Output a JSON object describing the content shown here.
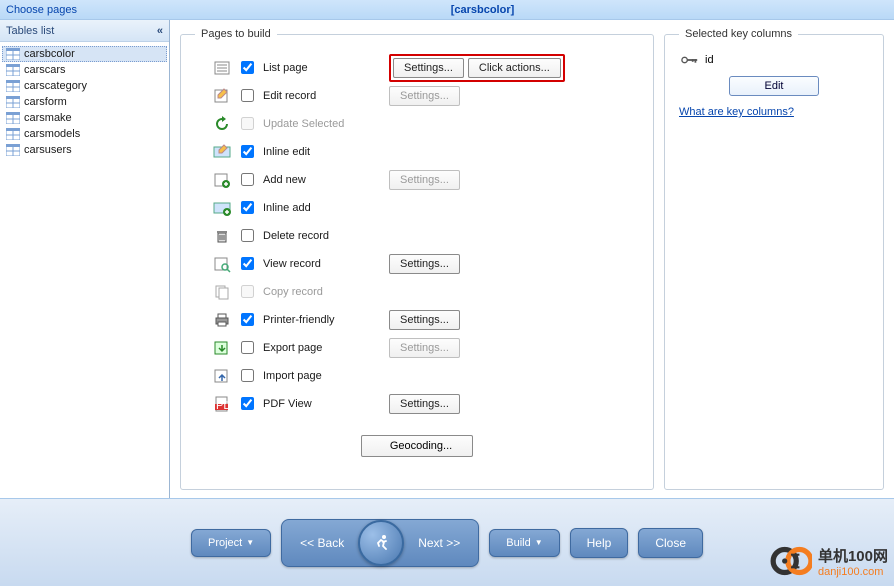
{
  "titlebar": {
    "left": "Choose pages",
    "center": "[carsbcolor]"
  },
  "sidebar": {
    "title": "Tables list",
    "items": [
      {
        "label": "carsbcolor",
        "selected": true
      },
      {
        "label": "carscars"
      },
      {
        "label": "carscategory"
      },
      {
        "label": "carsform"
      },
      {
        "label": "carsmake"
      },
      {
        "label": "carsmodels"
      },
      {
        "label": "carsusers"
      }
    ]
  },
  "pages": {
    "legend": "Pages to build",
    "settings_label": "Settings...",
    "click_actions_label": "Click actions...",
    "geocoding_label": "Geocoding...",
    "rows": [
      {
        "name": "list-page",
        "label": "List page",
        "checked": true,
        "settings": "enabled",
        "extra": "click_actions",
        "highlight": true,
        "icon": "list"
      },
      {
        "name": "edit-record",
        "label": "Edit record",
        "checked": false,
        "settings": "disabled",
        "icon": "edit"
      },
      {
        "name": "update-selected",
        "label": "Update Selected",
        "checked": false,
        "disabled": true,
        "icon": "update"
      },
      {
        "name": "inline-edit",
        "label": "Inline edit",
        "checked": true,
        "icon": "inline-edit"
      },
      {
        "name": "add-new",
        "label": "Add new",
        "checked": false,
        "settings": "disabled",
        "icon": "add"
      },
      {
        "name": "inline-add",
        "label": "Inline add",
        "checked": true,
        "icon": "inline-add"
      },
      {
        "name": "delete-record",
        "label": "Delete record",
        "checked": false,
        "icon": "delete"
      },
      {
        "name": "view-record",
        "label": "View record",
        "checked": true,
        "settings": "enabled",
        "icon": "view"
      },
      {
        "name": "copy-record",
        "label": "Copy record",
        "checked": false,
        "disabled": true,
        "icon": "copy"
      },
      {
        "name": "printer-friendly",
        "label": "Printer-friendly",
        "checked": true,
        "settings": "enabled",
        "icon": "print"
      },
      {
        "name": "export-page",
        "label": "Export page",
        "checked": false,
        "settings": "disabled",
        "icon": "export"
      },
      {
        "name": "import-page",
        "label": "Import page",
        "checked": false,
        "icon": "import"
      },
      {
        "name": "pdf-view",
        "label": "PDF View",
        "checked": true,
        "settings": "enabled",
        "icon": "pdf"
      }
    ]
  },
  "keycols": {
    "legend": "Selected key columns",
    "id_label": "id",
    "edit_label": "Edit",
    "help_link": "What are key columns?"
  },
  "footer": {
    "project": "Project",
    "back": "<<  Back",
    "next": "Next  >>",
    "build": "Build",
    "help": "Help",
    "close": "Close"
  },
  "watermark": {
    "text": "单机100网",
    "sub": "danji100.com"
  }
}
